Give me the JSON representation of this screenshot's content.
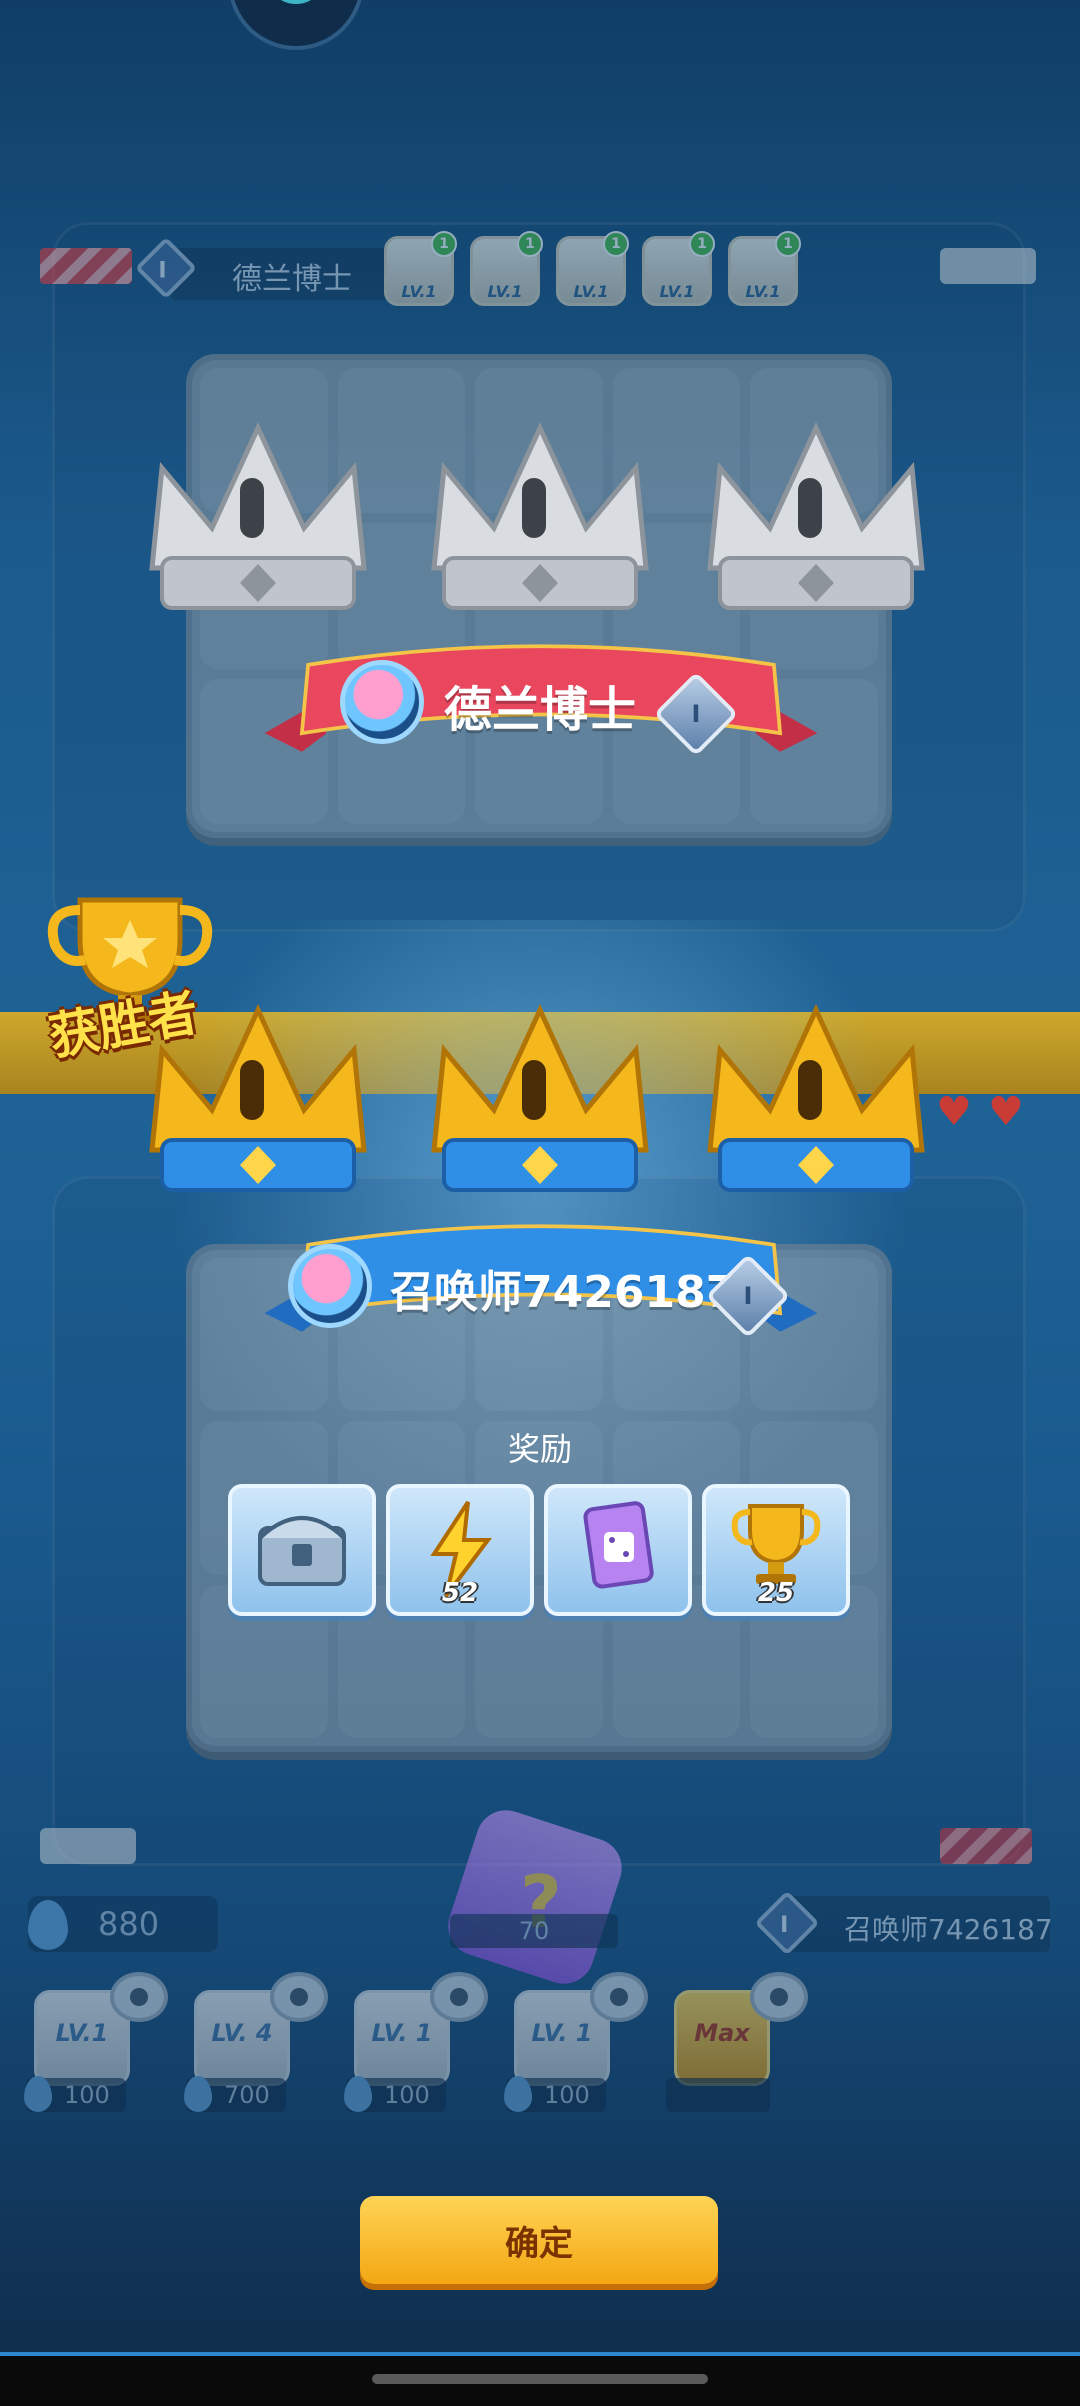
{
  "opponent": {
    "name": "德兰博士",
    "rank": "I",
    "tokens": [
      {
        "icon": "hand-icon",
        "level": "LV.1",
        "badge": "1"
      },
      {
        "icon": "cloud-icon",
        "level": "LV.1",
        "badge": "1"
      },
      {
        "icon": "fire-icon",
        "level": "LV.1",
        "badge": "1"
      },
      {
        "icon": "swirl-icon",
        "level": "LV.1",
        "badge": "1"
      },
      {
        "icon": "water-icon",
        "level": "LV.1",
        "badge": "1"
      }
    ]
  },
  "player": {
    "name": "召唤师7426187",
    "rank": "I",
    "mana": "880",
    "summon_cost": "70"
  },
  "result": {
    "winner_label": "获胜者"
  },
  "rewards": {
    "title": "奖励",
    "items": [
      {
        "icon": "chest-icon",
        "count": ""
      },
      {
        "icon": "lightning-icon",
        "count": "52"
      },
      {
        "icon": "dice-card-icon",
        "count": ""
      },
      {
        "icon": "trophy-icon",
        "count": "25"
      }
    ]
  },
  "upgrades": [
    {
      "label": "LV.1",
      "cost": "100"
    },
    {
      "label": "LV. 4",
      "cost": "700"
    },
    {
      "label": "LV. 1",
      "cost": "100"
    },
    {
      "label": "LV. 1",
      "cost": "100"
    },
    {
      "label": "Max",
      "cost": ""
    }
  ],
  "confirm_label": "确定",
  "colors": {
    "silver_crown": "#d9dde1",
    "gold_crown": "#f4b81c",
    "red_ribbon": "#e8475e",
    "blue_ribbon": "#2f8fe6",
    "confirm_button": "#f7b52a"
  }
}
